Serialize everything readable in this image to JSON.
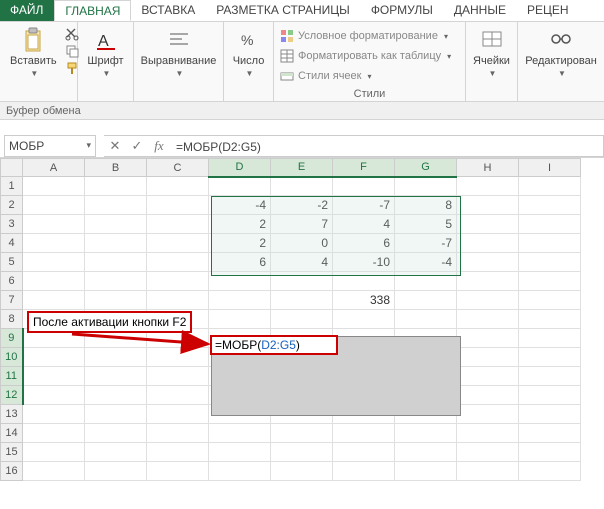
{
  "tabs": {
    "file": "ФАЙЛ",
    "home": "ГЛАВНАЯ",
    "insert": "ВСТАВКА",
    "pageLayout": "РАЗМЕТКА СТРАНИЦЫ",
    "formulas": "ФОРМУЛЫ",
    "data": "ДАННЫЕ",
    "review": "РЕЦЕН"
  },
  "ribbon": {
    "paste": "Вставить",
    "clipboard": "Буфер обмена",
    "font": "Шрифт",
    "alignment": "Выравнивание",
    "number": "Число",
    "condFmt": "Условное форматирование",
    "fmtTable": "Форматировать как таблицу",
    "cellStyles": "Стили ячеек",
    "stylesGroup": "Стили",
    "cells": "Ячейки",
    "editing": "Редактирован"
  },
  "namebox": "МОБР",
  "formula": "=МОБР(D2:G5)",
  "columns": [
    "A",
    "B",
    "C",
    "D",
    "E",
    "F",
    "G",
    "H",
    "I"
  ],
  "rows": [
    "1",
    "2",
    "3",
    "4",
    "5",
    "6",
    "7",
    "8",
    "9",
    "10",
    "11",
    "12",
    "13",
    "14",
    "15",
    "16"
  ],
  "cells": {
    "D2": "-4",
    "E2": "-2",
    "F2": "-7",
    "G2": "8",
    "D3": "2",
    "E3": "7",
    "F3": "4",
    "G3": "5",
    "D4": "2",
    "E4": "0",
    "F4": "6",
    "G4": "-7",
    "D5": "6",
    "E5": "4",
    "F5": "-10",
    "G5": "-4",
    "F7": "338"
  },
  "callout": "После активации кнопки F2",
  "activeFormula": {
    "prefix": "=МОБР(",
    "ref": "D2:G5",
    "suffix": ")"
  }
}
